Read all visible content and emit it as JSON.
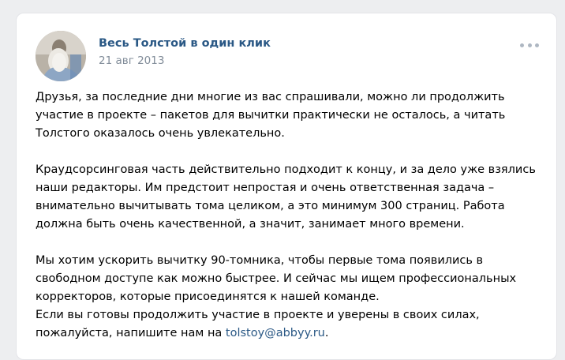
{
  "post": {
    "author": "Весь Толстой в один клик",
    "date": "21 авг 2013",
    "more_icon": "more-horizontal-icon",
    "avatar": "tolstoy-portrait",
    "paragraph1": [
      "Друзья, за последние дни многие из вас спрашивали, можно ли продолжить",
      "участие в проекте – пакетов для вычитки практически не осталось, а читать",
      "Толстого оказалось очень увлекательно."
    ],
    "paragraph2": [
      "Краудсорсинговая часть действительно подходит к концу, и за дело уже взялись",
      "наши редакторы. Им предстоит непростая и очень ответственная задача –",
      "внимательно вычитывать тома целиком, а это минимум 300 страниц. Работа",
      "должна быть очень качественной, а значит, занимает много времени."
    ],
    "paragraph3": [
      "Мы хотим ускорить вычитку 90-томника, чтобы первые тома появились в",
      "свободном доступе как можно быстрее. И сейчас мы ищем профессиональных",
      "корректоров, которые присоединятся к нашей команде."
    ],
    "paragraph4": [
      "Если вы готовы продолжить участие в проекте и уверены в своих силах,"
    ],
    "last_line_prefix": "пожалуйста, напишите нам на ",
    "email": "tolstoy@abbyy.ru",
    "last_line_suffix": ".",
    "colors": {
      "link": "#2a5885",
      "date": "#818c99",
      "background": "#edeef0"
    }
  }
}
